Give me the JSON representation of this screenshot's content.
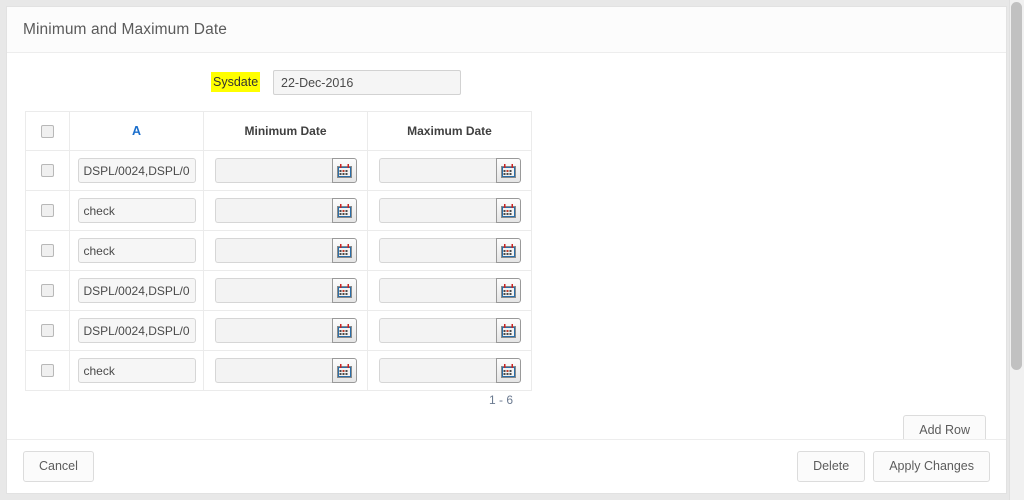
{
  "region": {
    "title": "Minimum and Maximum Date"
  },
  "sysdate": {
    "label": "Sysdate",
    "value": "22-Dec-2016",
    "placeholder": ""
  },
  "grid": {
    "headers": {
      "select_all": "",
      "a": "A",
      "minimum_date": "Minimum Date",
      "maximum_date": "Maximum Date"
    },
    "rows": [
      {
        "a": "DSPL/0024,DSPL/00",
        "min": "",
        "max": ""
      },
      {
        "a": "check",
        "min": "",
        "max": ""
      },
      {
        "a": "check",
        "min": "",
        "max": ""
      },
      {
        "a": "DSPL/0024,DSPL/00",
        "min": "",
        "max": ""
      },
      {
        "a": "DSPL/0024,DSPL/00",
        "min": "",
        "max": ""
      },
      {
        "a": "check",
        "min": "",
        "max": ""
      }
    ],
    "pagination": "1 - 6"
  },
  "buttons": {
    "add_row": "Add Row",
    "cancel": "Cancel",
    "delete": "Delete",
    "apply_changes": "Apply Changes"
  },
  "icons": {
    "calendar": "calendar-icon"
  },
  "colors": {
    "link": "#1a6ecc",
    "highlight": "#ffff00",
    "page_background": "#e8e8e8",
    "panel": "#ffffff"
  }
}
